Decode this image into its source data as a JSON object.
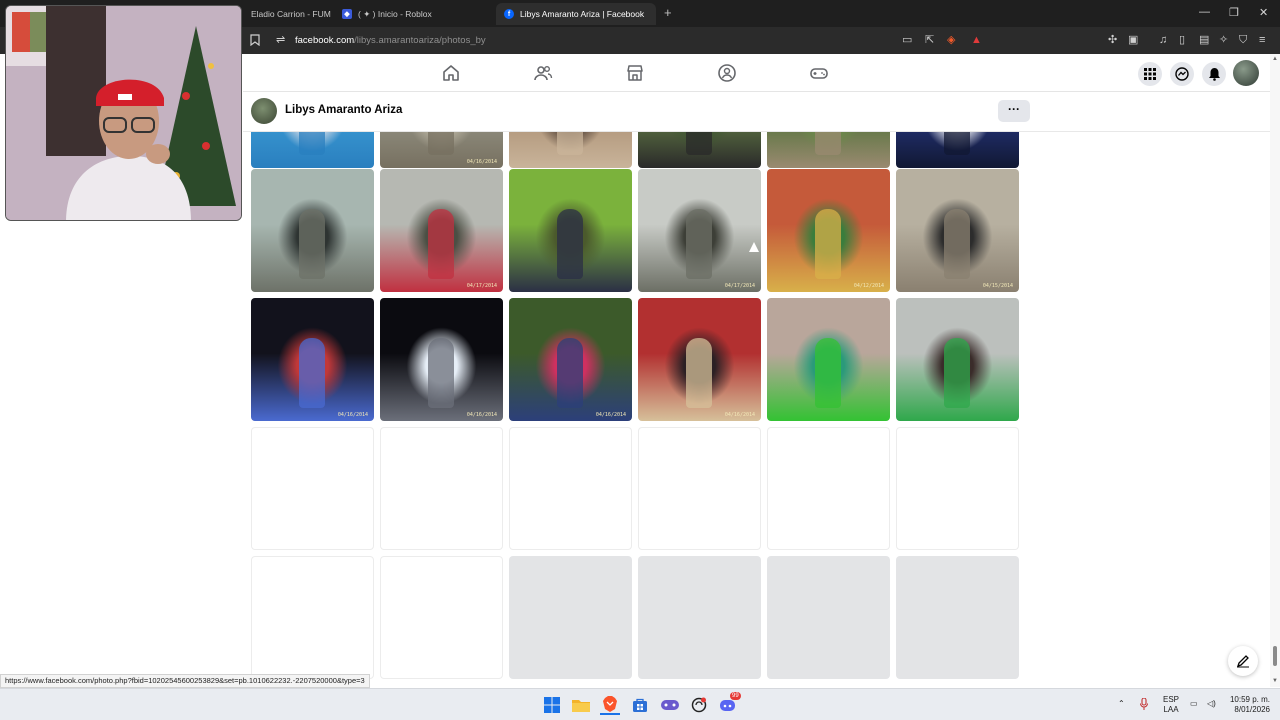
{
  "browser": {
    "tabs": [
      {
        "title": "Eladio Carrion - FUM",
        "active": false,
        "icon": "music-favicon"
      },
      {
        "title": "( ✦ ) Inicio - Roblox",
        "active": false,
        "icon": "roblox-favicon"
      },
      {
        "title": "Libys Amaranto Ariza | Facebook",
        "active": true,
        "icon": "facebook-favicon"
      }
    ],
    "new_tab": "+",
    "url_domain": "facebook.com",
    "url_path": "/libys.amarantoariza/photos_by",
    "hover_status_url": "https://www.facebook.com/photo.php?fbid=10202545600253829&set=pb.1010622232.-2207520000&type=3"
  },
  "facebook": {
    "profile_name": "Libys Amaranto Ariza",
    "more_button": "···",
    "accent_color": "#0866ff",
    "nav_icons": [
      "home-icon",
      "friends-icon",
      "marketplace-icon",
      "groups-icon",
      "gaming-icon"
    ],
    "right_icons": [
      "menu-grid-icon",
      "messenger-icon",
      "notifications-icon",
      "account-avatar"
    ]
  },
  "photos": {
    "rows": [
      {
        "state": "loaded-cropped",
        "items": [
          {
            "label": "",
            "palette": "blue-shirt"
          },
          {
            "label": "04/16/2014",
            "palette": "stone"
          },
          {
            "label": "",
            "palette": "brown"
          },
          {
            "label": "",
            "palette": "grass"
          },
          {
            "label": "",
            "palette": "garden"
          },
          {
            "label": "",
            "palette": "blue-dark"
          }
        ]
      },
      {
        "state": "loaded",
        "items": [
          {
            "label": "",
            "palette": "truck"
          },
          {
            "label": "04/17/2014",
            "palette": "rock-road"
          },
          {
            "label": "",
            "palette": "tree-grass"
          },
          {
            "label": "04/17/2014",
            "palette": "rock-crowd"
          },
          {
            "label": "04/12/2014",
            "palette": "colorful-street"
          },
          {
            "label": "04/15/2014",
            "palette": "plaza-jump"
          }
        ]
      },
      {
        "state": "loaded",
        "items": [
          {
            "label": "04/16/2014",
            "palette": "night-bus"
          },
          {
            "label": "04/16/2014",
            "palette": "light-tubes"
          },
          {
            "label": "04/16/2014",
            "palette": "forest-group"
          },
          {
            "label": "04/16/2014",
            "palette": "shop-red"
          },
          {
            "label": "",
            "palette": "party-green"
          },
          {
            "label": "",
            "palette": "party-table"
          }
        ]
      },
      {
        "state": "empty",
        "items": [
          {},
          {},
          {},
          {},
          {},
          {}
        ]
      },
      {
        "state": "mixed",
        "items": [
          {
            "state": "empty"
          },
          {
            "state": "empty"
          },
          {
            "state": "loading"
          },
          {
            "state": "loading"
          },
          {
            "state": "loading"
          },
          {
            "state": "loading"
          }
        ]
      }
    ]
  },
  "taskbar": {
    "apps": [
      "windows-start-icon",
      "file-explorer-icon",
      "brave-browser-icon",
      "microsoft-store-icon",
      "game-controller-icon",
      "chatgpt-icon",
      "discord-icon"
    ],
    "discord_badge": "99",
    "language_line1": "ESP",
    "language_line2": "LAA",
    "time": "10:59 p. m.",
    "date": "8/01/2026"
  }
}
